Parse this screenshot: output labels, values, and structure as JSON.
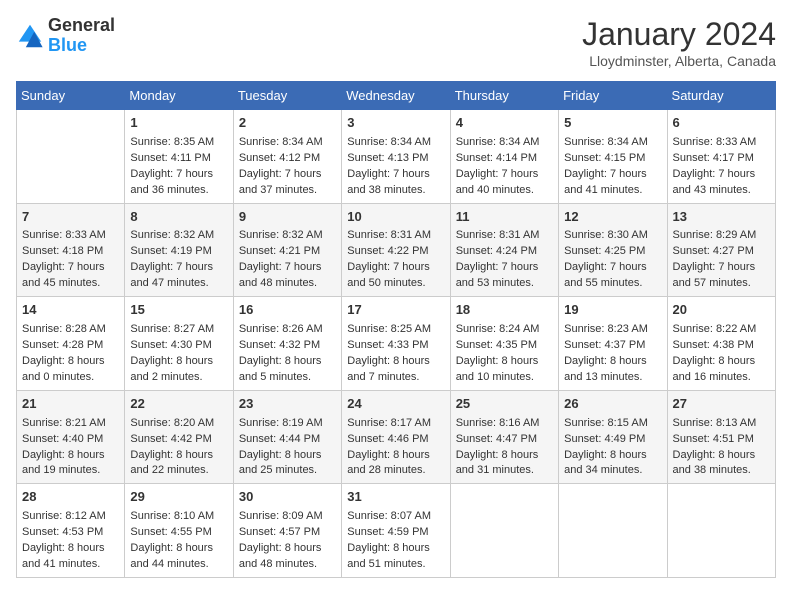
{
  "logo": {
    "general": "General",
    "blue": "Blue"
  },
  "title": "January 2024",
  "subtitle": "Lloydminster, Alberta, Canada",
  "days_of_week": [
    "Sunday",
    "Monday",
    "Tuesday",
    "Wednesday",
    "Thursday",
    "Friday",
    "Saturday"
  ],
  "weeks": [
    [
      {
        "day": "",
        "sunrise": "",
        "sunset": "",
        "daylight": ""
      },
      {
        "day": "1",
        "sunrise": "Sunrise: 8:35 AM",
        "sunset": "Sunset: 4:11 PM",
        "daylight": "Daylight: 7 hours and 36 minutes."
      },
      {
        "day": "2",
        "sunrise": "Sunrise: 8:34 AM",
        "sunset": "Sunset: 4:12 PM",
        "daylight": "Daylight: 7 hours and 37 minutes."
      },
      {
        "day": "3",
        "sunrise": "Sunrise: 8:34 AM",
        "sunset": "Sunset: 4:13 PM",
        "daylight": "Daylight: 7 hours and 38 minutes."
      },
      {
        "day": "4",
        "sunrise": "Sunrise: 8:34 AM",
        "sunset": "Sunset: 4:14 PM",
        "daylight": "Daylight: 7 hours and 40 minutes."
      },
      {
        "day": "5",
        "sunrise": "Sunrise: 8:34 AM",
        "sunset": "Sunset: 4:15 PM",
        "daylight": "Daylight: 7 hours and 41 minutes."
      },
      {
        "day": "6",
        "sunrise": "Sunrise: 8:33 AM",
        "sunset": "Sunset: 4:17 PM",
        "daylight": "Daylight: 7 hours and 43 minutes."
      }
    ],
    [
      {
        "day": "7",
        "sunrise": "Sunrise: 8:33 AM",
        "sunset": "Sunset: 4:18 PM",
        "daylight": "Daylight: 7 hours and 45 minutes."
      },
      {
        "day": "8",
        "sunrise": "Sunrise: 8:32 AM",
        "sunset": "Sunset: 4:19 PM",
        "daylight": "Daylight: 7 hours and 47 minutes."
      },
      {
        "day": "9",
        "sunrise": "Sunrise: 8:32 AM",
        "sunset": "Sunset: 4:21 PM",
        "daylight": "Daylight: 7 hours and 48 minutes."
      },
      {
        "day": "10",
        "sunrise": "Sunrise: 8:31 AM",
        "sunset": "Sunset: 4:22 PM",
        "daylight": "Daylight: 7 hours and 50 minutes."
      },
      {
        "day": "11",
        "sunrise": "Sunrise: 8:31 AM",
        "sunset": "Sunset: 4:24 PM",
        "daylight": "Daylight: 7 hours and 53 minutes."
      },
      {
        "day": "12",
        "sunrise": "Sunrise: 8:30 AM",
        "sunset": "Sunset: 4:25 PM",
        "daylight": "Daylight: 7 hours and 55 minutes."
      },
      {
        "day": "13",
        "sunrise": "Sunrise: 8:29 AM",
        "sunset": "Sunset: 4:27 PM",
        "daylight": "Daylight: 7 hours and 57 minutes."
      }
    ],
    [
      {
        "day": "14",
        "sunrise": "Sunrise: 8:28 AM",
        "sunset": "Sunset: 4:28 PM",
        "daylight": "Daylight: 8 hours and 0 minutes."
      },
      {
        "day": "15",
        "sunrise": "Sunrise: 8:27 AM",
        "sunset": "Sunset: 4:30 PM",
        "daylight": "Daylight: 8 hours and 2 minutes."
      },
      {
        "day": "16",
        "sunrise": "Sunrise: 8:26 AM",
        "sunset": "Sunset: 4:32 PM",
        "daylight": "Daylight: 8 hours and 5 minutes."
      },
      {
        "day": "17",
        "sunrise": "Sunrise: 8:25 AM",
        "sunset": "Sunset: 4:33 PM",
        "daylight": "Daylight: 8 hours and 7 minutes."
      },
      {
        "day": "18",
        "sunrise": "Sunrise: 8:24 AM",
        "sunset": "Sunset: 4:35 PM",
        "daylight": "Daylight: 8 hours and 10 minutes."
      },
      {
        "day": "19",
        "sunrise": "Sunrise: 8:23 AM",
        "sunset": "Sunset: 4:37 PM",
        "daylight": "Daylight: 8 hours and 13 minutes."
      },
      {
        "day": "20",
        "sunrise": "Sunrise: 8:22 AM",
        "sunset": "Sunset: 4:38 PM",
        "daylight": "Daylight: 8 hours and 16 minutes."
      }
    ],
    [
      {
        "day": "21",
        "sunrise": "Sunrise: 8:21 AM",
        "sunset": "Sunset: 4:40 PM",
        "daylight": "Daylight: 8 hours and 19 minutes."
      },
      {
        "day": "22",
        "sunrise": "Sunrise: 8:20 AM",
        "sunset": "Sunset: 4:42 PM",
        "daylight": "Daylight: 8 hours and 22 minutes."
      },
      {
        "day": "23",
        "sunrise": "Sunrise: 8:19 AM",
        "sunset": "Sunset: 4:44 PM",
        "daylight": "Daylight: 8 hours and 25 minutes."
      },
      {
        "day": "24",
        "sunrise": "Sunrise: 8:17 AM",
        "sunset": "Sunset: 4:46 PM",
        "daylight": "Daylight: 8 hours and 28 minutes."
      },
      {
        "day": "25",
        "sunrise": "Sunrise: 8:16 AM",
        "sunset": "Sunset: 4:47 PM",
        "daylight": "Daylight: 8 hours and 31 minutes."
      },
      {
        "day": "26",
        "sunrise": "Sunrise: 8:15 AM",
        "sunset": "Sunset: 4:49 PM",
        "daylight": "Daylight: 8 hours and 34 minutes."
      },
      {
        "day": "27",
        "sunrise": "Sunrise: 8:13 AM",
        "sunset": "Sunset: 4:51 PM",
        "daylight": "Daylight: 8 hours and 38 minutes."
      }
    ],
    [
      {
        "day": "28",
        "sunrise": "Sunrise: 8:12 AM",
        "sunset": "Sunset: 4:53 PM",
        "daylight": "Daylight: 8 hours and 41 minutes."
      },
      {
        "day": "29",
        "sunrise": "Sunrise: 8:10 AM",
        "sunset": "Sunset: 4:55 PM",
        "daylight": "Daylight: 8 hours and 44 minutes."
      },
      {
        "day": "30",
        "sunrise": "Sunrise: 8:09 AM",
        "sunset": "Sunset: 4:57 PM",
        "daylight": "Daylight: 8 hours and 48 minutes."
      },
      {
        "day": "31",
        "sunrise": "Sunrise: 8:07 AM",
        "sunset": "Sunset: 4:59 PM",
        "daylight": "Daylight: 8 hours and 51 minutes."
      },
      {
        "day": "",
        "sunrise": "",
        "sunset": "",
        "daylight": ""
      },
      {
        "day": "",
        "sunrise": "",
        "sunset": "",
        "daylight": ""
      },
      {
        "day": "",
        "sunrise": "",
        "sunset": "",
        "daylight": ""
      }
    ]
  ]
}
